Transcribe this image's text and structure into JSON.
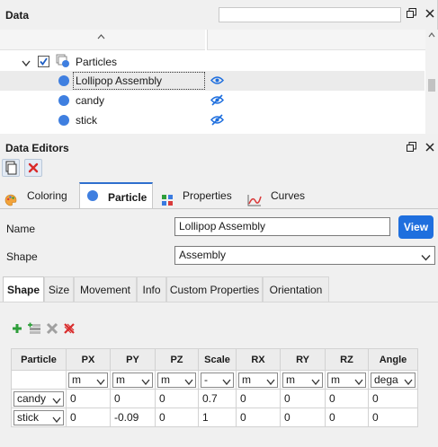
{
  "data_panel": {
    "title": "Data",
    "search": {
      "value": "",
      "placeholder": ""
    },
    "tree": {
      "group_label": "Particles",
      "group_checked": true,
      "items": [
        {
          "label": "Lollipop Assembly",
          "selected": true,
          "visible": true
        },
        {
          "label": "candy",
          "selected": false,
          "visible": false
        },
        {
          "label": "stick",
          "selected": false,
          "visible": false
        }
      ]
    }
  },
  "editors_panel": {
    "title": "Data Editors",
    "main_tabs": [
      {
        "label": "Coloring",
        "icon": "palette-icon",
        "active": false
      },
      {
        "label": "Particle",
        "icon": "particle-dot-icon",
        "active": true
      },
      {
        "label": "Properties",
        "icon": "properties-grid-icon",
        "active": false
      },
      {
        "label": "Curves",
        "icon": "curve-chart-icon",
        "active": false
      }
    ],
    "name_label": "Name",
    "name_value": "Lollipop Assembly",
    "view_button": "View",
    "shape_label": "Shape",
    "shape_value": "Assembly",
    "sub_tabs": [
      {
        "label": "Shape",
        "active": true
      },
      {
        "label": "Size",
        "active": false
      },
      {
        "label": "Movement",
        "active": false
      },
      {
        "label": "Info",
        "active": false
      },
      {
        "label": "Custom Properties",
        "active": false
      },
      {
        "label": "Orientation",
        "active": false
      }
    ],
    "grid": {
      "headers": [
        "Particle",
        "PX",
        "PY",
        "PZ",
        "Scale",
        "RX",
        "RY",
        "RZ",
        "Angle"
      ],
      "units": [
        "m",
        "m",
        "m",
        "-",
        "m",
        "m",
        "m",
        "dega"
      ],
      "rows": [
        {
          "particle": "candy",
          "values": [
            "0",
            "0",
            "0",
            "0.7",
            "0",
            "0",
            "0",
            "0"
          ]
        },
        {
          "particle": "stick",
          "values": [
            "0",
            "-0.09",
            "0",
            "1",
            "0",
            "0",
            "0",
            "0"
          ]
        }
      ]
    }
  },
  "colors": {
    "accent": "#2f6fce",
    "view_button": "#1f6fde",
    "particle_dot": "#3f7fe0",
    "delete_red": "#d92b2b",
    "add_green": "#2e9e3a"
  }
}
